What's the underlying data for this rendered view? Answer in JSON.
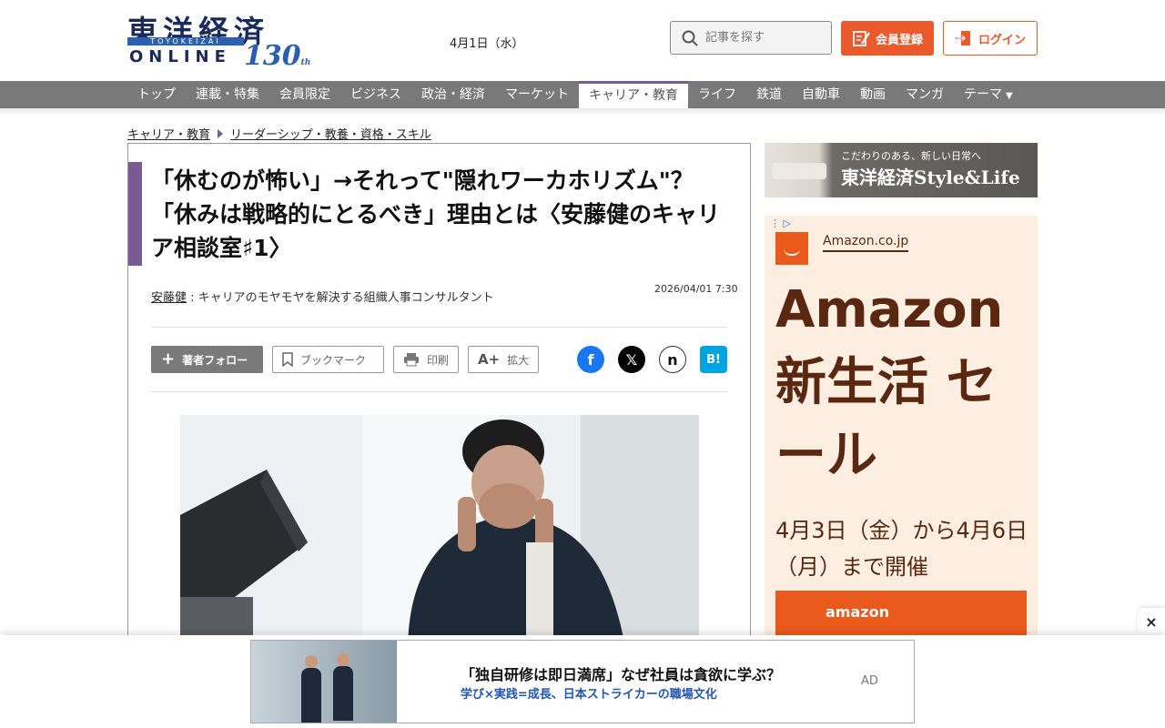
{
  "header": {
    "logo_kanji": "東洋経済",
    "logo_bar": "TOYOKEIZAI",
    "logo_online": "ONLINE",
    "logo_anniv": "130",
    "logo_anniv_suffix": "th",
    "date": "4月1日（水）",
    "search_placeholder": "記事を探す",
    "register_label": "会員登録",
    "login_label": "ログイン"
  },
  "nav": {
    "items": [
      "トップ",
      "連載・特集",
      "会員限定",
      "ビジネス",
      "政治・経済",
      "マーケット",
      "キャリア・教育",
      "ライフ",
      "鉄道",
      "自動車",
      "動画",
      "マンガ",
      "テーマ"
    ],
    "active_index": 6
  },
  "breadcrumb": [
    "キャリア・教育",
    "リーダーシップ・教養・資格・スキル"
  ],
  "article": {
    "title": "「休むのが怖い」→それって\"隠れワーカホリズム\"？　「休みは戦略的にとるべき」理由とは〈安藤健のキャリア相談室♯1〉",
    "author_name": "安藤健",
    "author_desc": " : キャリアのモヤモヤを解決する組織人事コンサルタント",
    "date": "2026/04/01 7:30",
    "tools": {
      "follow": "著者フォロー",
      "bookmark": "ブックマーク",
      "print": "印刷",
      "zoom": "拡大"
    }
  },
  "sidebar": {
    "style_sub": "こだわりのある、新しい日常へ",
    "style_main": "東洋経済Style&Life",
    "amazon_name": "Amazon.co.jp",
    "amazon_headline": "Amazon 新生活 セール",
    "amazon_dates": "4月3日（金）から4月6日（月）まで開催",
    "amazon_logo_text": "amazon"
  },
  "bottom_ad": {
    "title": "「独自研修は即日満席」なぜ社員は貪欲に学ぶ？",
    "subtitle": "学び×実践=成長、日本ストライカーの職場文化",
    "ad_label": "AD",
    "close": "×"
  },
  "colors": {
    "accent_purple": "#7a5a92",
    "brand_orange": "#ea5a2c",
    "nav_gray": "#797979",
    "amazon_brown": "#5a2810"
  }
}
